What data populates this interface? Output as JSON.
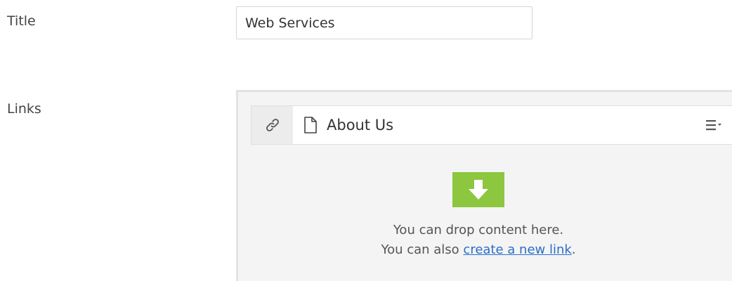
{
  "form": {
    "title_label": "Title",
    "title_value": "Web Services",
    "links_label": "Links"
  },
  "links": {
    "items": [
      {
        "name": "About Us",
        "icon": "page-icon"
      }
    ],
    "handle_icon": "link-icon",
    "menu_icon": "menu-dropdown-icon",
    "drop_icon": "download-arrow-icon",
    "drop_text_1": "You can drop content here.",
    "drop_text_2_prefix": "You can also ",
    "drop_text_2_link": "create a new link",
    "drop_text_2_suffix": "."
  },
  "colors": {
    "accent_green": "#8dc63f",
    "link_blue": "#2a6fc9"
  }
}
